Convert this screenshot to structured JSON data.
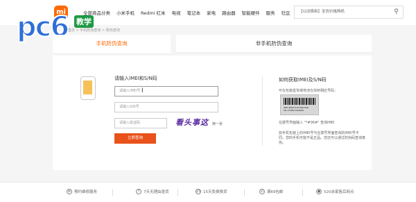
{
  "header": {
    "logo_text": "mi",
    "nav": [
      "全部商品分类",
      "小米手机",
      "Redmi 红米",
      "电视",
      "笔记本",
      "家电",
      "路由器",
      "智能硬件",
      "服务",
      "社区"
    ],
    "search_placeholder": "【以旧换新】至尚价格购机",
    "search_icon": "magnifier"
  },
  "watermark": {
    "text": "pc6",
    "badge": "教学"
  },
  "breadcrumb": "首页 > 手机防伪查询 > 防伪查询",
  "tabs": [
    {
      "label": "手机防伪查询",
      "active": true
    },
    {
      "label": "非手机防伪查询",
      "active": false
    }
  ],
  "form": {
    "title": "请输入IMEI和S/N码",
    "imei_placeholder": "请输入IMEI号",
    "sn_placeholder": "请输入S/N号",
    "captcha_placeholder": "请输入验证码",
    "captcha_text": "看头事这",
    "refresh_label": "换一张",
    "submit_label": "立即查询",
    "cursor": "I"
  },
  "help": {
    "title": "如何获取IMEI及S/N码",
    "sub": "可在包装盒背或电池仓找到相应号码：",
    "barcode_lines": [
      "IMEI 866071927662308",
      "SN 17985/3149680"
    ],
    "p1": "在拨号界面输入 \"*#06#\" 查询IMEI",
    "p2": "如手机包装上的IMEI号与在拨号界面查询的IMEI号不同，您的手机可能不是正品。您还可以通过防伪码查询真伪。"
  },
  "footer": {
    "items": [
      {
        "icon": "wrench",
        "label": "预约维修服务"
      },
      {
        "icon": "7",
        "label": "7天无理由退货"
      },
      {
        "icon": "15",
        "label": "15天免费换货"
      },
      {
        "icon": "gift",
        "label": "满69包邮"
      },
      {
        "icon": "pin",
        "label": "520余家售后网点"
      }
    ]
  },
  "colors": {
    "accent": "#ff6700",
    "button": "#e9521b",
    "logo": "#ff6900",
    "pc6_blue": "#2f6fd8",
    "pc6_green": "#1d9a44"
  }
}
